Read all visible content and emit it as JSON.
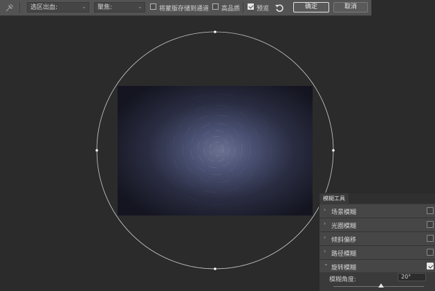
{
  "toolbar": {
    "selection_output_label": "选区出血:",
    "focus_label": "聚焦:",
    "save_mask_label": "将蒙版存储到通道",
    "high_quality_label": "高品质",
    "preview_label": "预览",
    "ok_label": "确定",
    "cancel_label": "取消",
    "save_mask_checked": false,
    "high_quality_checked": false,
    "preview_checked": true
  },
  "panel": {
    "tab_label": "模糊工具",
    "items": [
      {
        "label": "场景模糊",
        "expanded": false,
        "checked": false
      },
      {
        "label": "光圈模糊",
        "expanded": false,
        "checked": false
      },
      {
        "label": "倾斜偏移",
        "expanded": false,
        "checked": false
      },
      {
        "label": "路径模糊",
        "expanded": false,
        "checked": false
      },
      {
        "label": "旋转模糊",
        "expanded": true,
        "checked": true
      }
    ],
    "param": {
      "label": "模糊角度:",
      "value": "20°",
      "slider_fraction": 0.53
    }
  }
}
